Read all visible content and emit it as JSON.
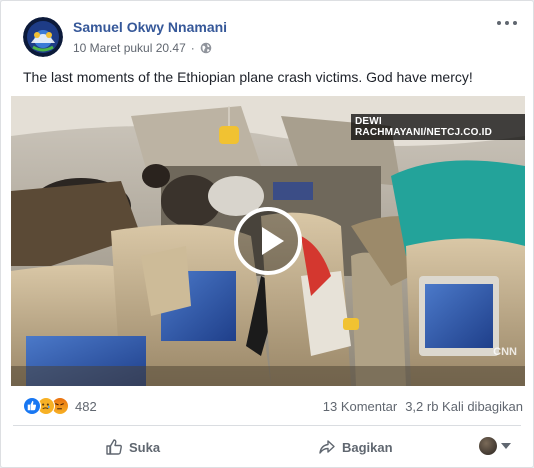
{
  "post": {
    "author": "Samuel Okwy Nnamani",
    "timestamp": "10 Maret pukul 20.47",
    "privacy_icon": "globe-icon",
    "message": "The last moments of the Ethiopian plane crash victims. God have mercy!"
  },
  "video": {
    "watermark": "DEWI RACHMAYANI/NETCJ.CO.ID",
    "corner_mark": "CNN",
    "play_icon": "play-icon"
  },
  "engagement": {
    "reactions": [
      "like-icon",
      "sad-icon",
      "angry-icon"
    ],
    "reaction_count": "482",
    "comments": "13 Komentar",
    "shares": "3,2 rb Kali dibagikan"
  },
  "actions": {
    "like_label": "Suka",
    "share_label": "Bagikan"
  },
  "colors": {
    "link": "#365899",
    "muted": "#616770",
    "like_blue": "#1877f2"
  }
}
